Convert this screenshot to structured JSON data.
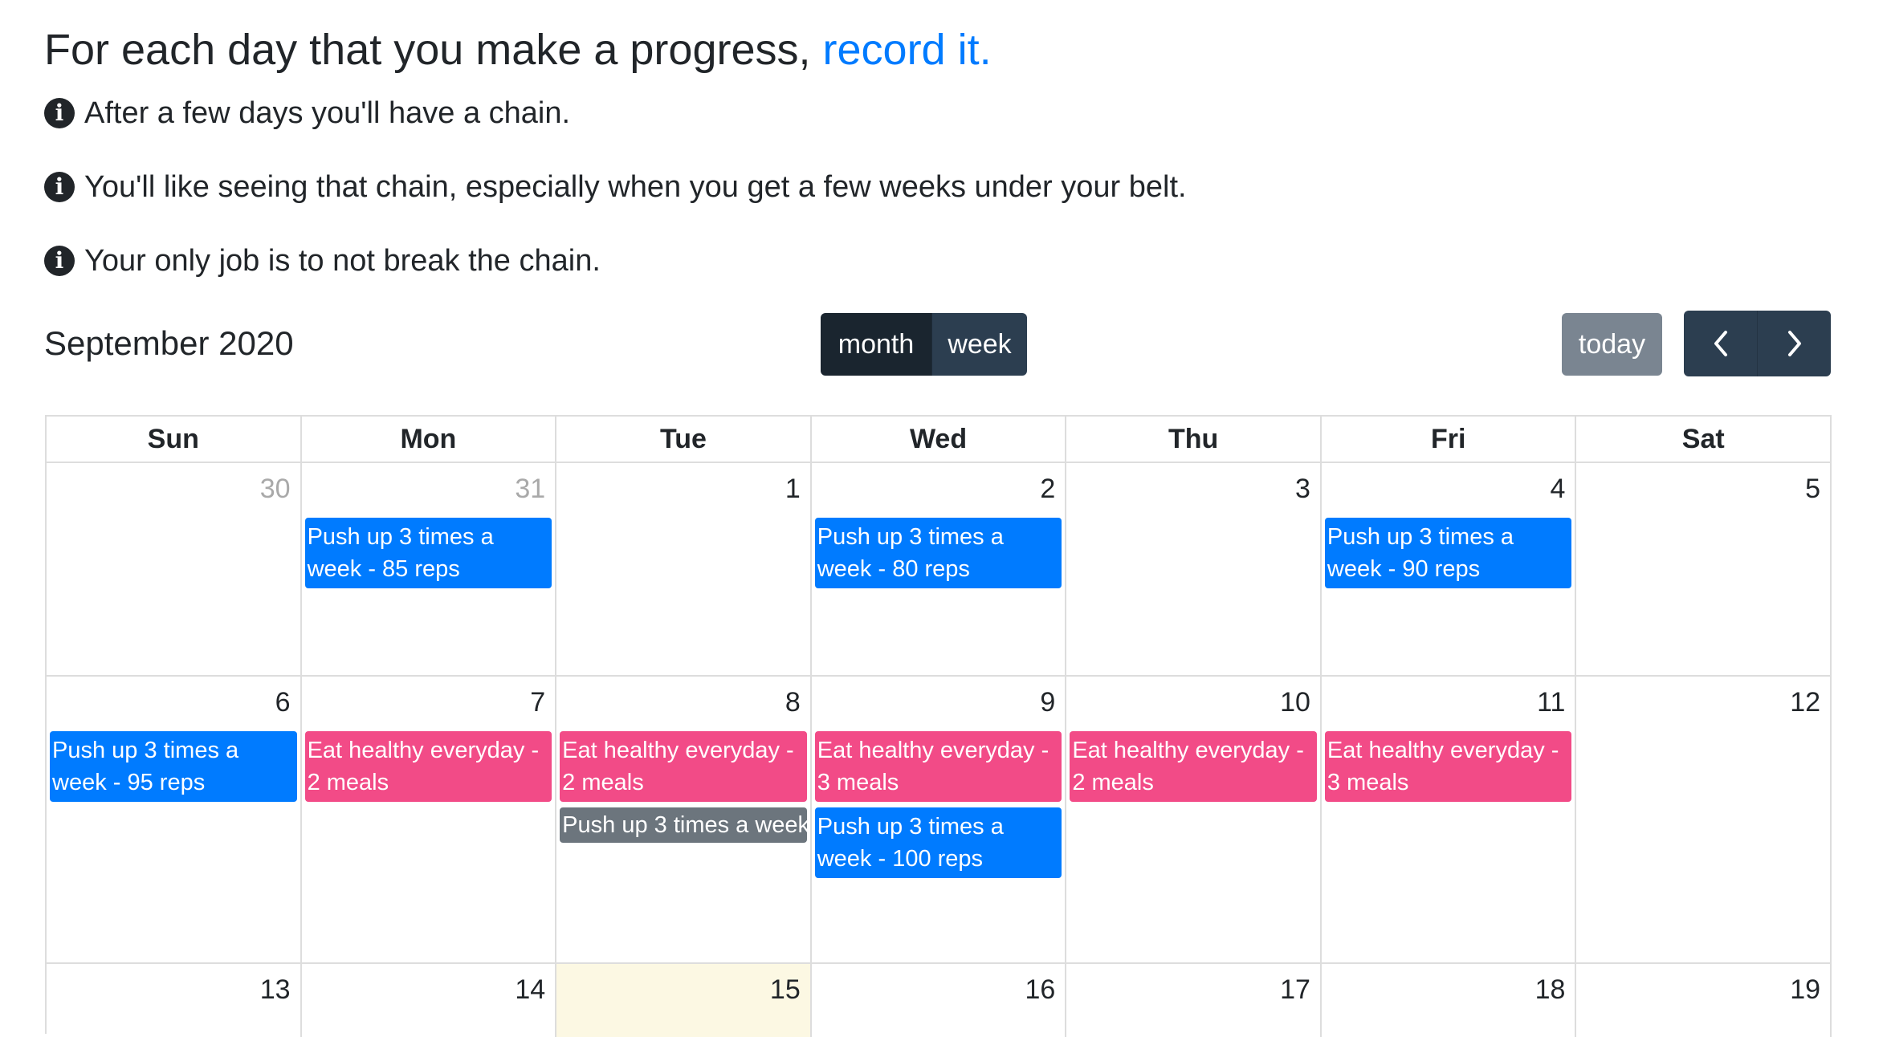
{
  "intro": {
    "headline_text": "For each day that you make a progress,",
    "headline_link": "record it.",
    "tips": [
      "After a few days you'll have a chain.",
      "You'll like seeing that chain, especially when you get a few weeks under your belt.",
      "Your only job is to not break the chain."
    ],
    "tip_icon": "info-circle-icon"
  },
  "toolbar": {
    "title": "September 2020",
    "views": [
      {
        "label": "month",
        "active": true
      },
      {
        "label": "week",
        "active": false
      }
    ],
    "today_label": "today",
    "prev_icon": "chevron-left-icon",
    "next_icon": "chevron-right-icon"
  },
  "calendar": {
    "weekdays": [
      "Sun",
      "Mon",
      "Tue",
      "Wed",
      "Thu",
      "Fri",
      "Sat"
    ],
    "highlighted_day": "15",
    "colors": {
      "push_up": "#007bff",
      "eat_healthy": "#f24b87",
      "pending": "#6c757d",
      "today_bg": "#fcf8e3"
    },
    "weeks": [
      [
        {
          "day": "30",
          "other_month": true,
          "events": []
        },
        {
          "day": "31",
          "other_month": true,
          "events": [
            {
              "title": "Push up 3 times a week - 85 reps",
              "color": "blue"
            }
          ]
        },
        {
          "day": "1",
          "events": []
        },
        {
          "day": "2",
          "events": [
            {
              "title": "Push up 3 times a week - 80 reps",
              "color": "blue"
            }
          ]
        },
        {
          "day": "3",
          "events": []
        },
        {
          "day": "4",
          "events": [
            {
              "title": "Push up 3 times a week - 90 reps",
              "color": "blue"
            }
          ]
        },
        {
          "day": "5",
          "events": []
        }
      ],
      [
        {
          "day": "6",
          "events": [
            {
              "title": "Push up 3 times a week - 95 reps",
              "color": "blue"
            }
          ]
        },
        {
          "day": "7",
          "events": [
            {
              "title": "Eat healthy everyday - 2 meals",
              "color": "pink"
            }
          ]
        },
        {
          "day": "8",
          "events": [
            {
              "title": "Eat healthy everyday - 2 meals",
              "color": "pink"
            },
            {
              "title": "Push up 3 times a week",
              "color": "gray"
            }
          ]
        },
        {
          "day": "9",
          "events": [
            {
              "title": "Eat healthy everyday - 3 meals",
              "color": "pink"
            },
            {
              "title": "Push up 3 times a week - 100 reps",
              "color": "blue"
            }
          ]
        },
        {
          "day": "10",
          "events": [
            {
              "title": "Eat healthy everyday - 2 meals",
              "color": "pink"
            }
          ]
        },
        {
          "day": "11",
          "events": [
            {
              "title": "Eat healthy everyday - 3 meals",
              "color": "pink"
            }
          ]
        },
        {
          "day": "12",
          "events": []
        }
      ],
      [
        {
          "day": "13",
          "events": []
        },
        {
          "day": "14",
          "events": []
        },
        {
          "day": "15",
          "today": true,
          "events": []
        },
        {
          "day": "16",
          "events": []
        },
        {
          "day": "17",
          "events": []
        },
        {
          "day": "18",
          "events": []
        },
        {
          "day": "19",
          "events": []
        }
      ]
    ]
  }
}
